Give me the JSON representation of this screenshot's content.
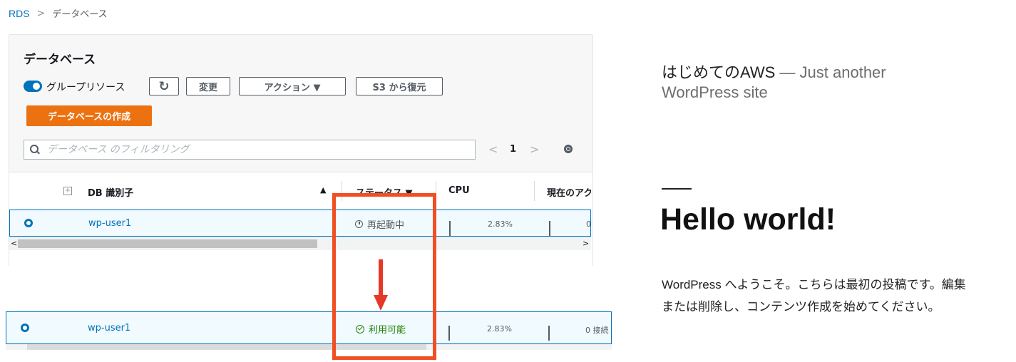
{
  "breadcrumb": {
    "root": "RDS",
    "separator": ">",
    "current": "データベース"
  },
  "panel": {
    "title": "データベース",
    "group_resources_label": "グループリソース",
    "refresh_icon": "refresh-icon",
    "modify_label": "変更",
    "actions_label": "アクション ▼",
    "restore_s3_label": "S3 から復元",
    "create_db_label": "データベースの作成",
    "search_placeholder": "データベース のフィルタリング",
    "pager": {
      "prev": "<",
      "page": "1",
      "next": ">"
    }
  },
  "table": {
    "columns": {
      "db_id": "DB 識別子",
      "db_id_sort": "▲",
      "status": "ステータス ▼",
      "cpu": "CPU",
      "current_activity": "現在のアク"
    },
    "row_before": {
      "db_id": "wp-user1",
      "status": "再起動中",
      "cpu_percent": 2.83,
      "cpu_text": "2.83%",
      "activity_text": "0"
    },
    "row_after": {
      "db_id": "wp-user1",
      "status": "利用可能",
      "cpu_percent": 2.83,
      "cpu_text": "2.83%",
      "activity_text": "0 接続"
    },
    "scroll_left": "<",
    "scroll_right": ">"
  },
  "colors": {
    "aws_blue": "#0073bb",
    "aws_orange": "#ec7211",
    "status_ok": "#1d8102",
    "annotation_red": "#f04e23"
  },
  "wordpress": {
    "site_name": "はじめてのAWS",
    "dash": "—",
    "tagline": "Just another WordPress site",
    "post_title": "Hello world!",
    "post_body": "WordPress へようこそ。こちらは最初の投稿です。編集または削除し、コンテンツ作成を始めてください。"
  }
}
